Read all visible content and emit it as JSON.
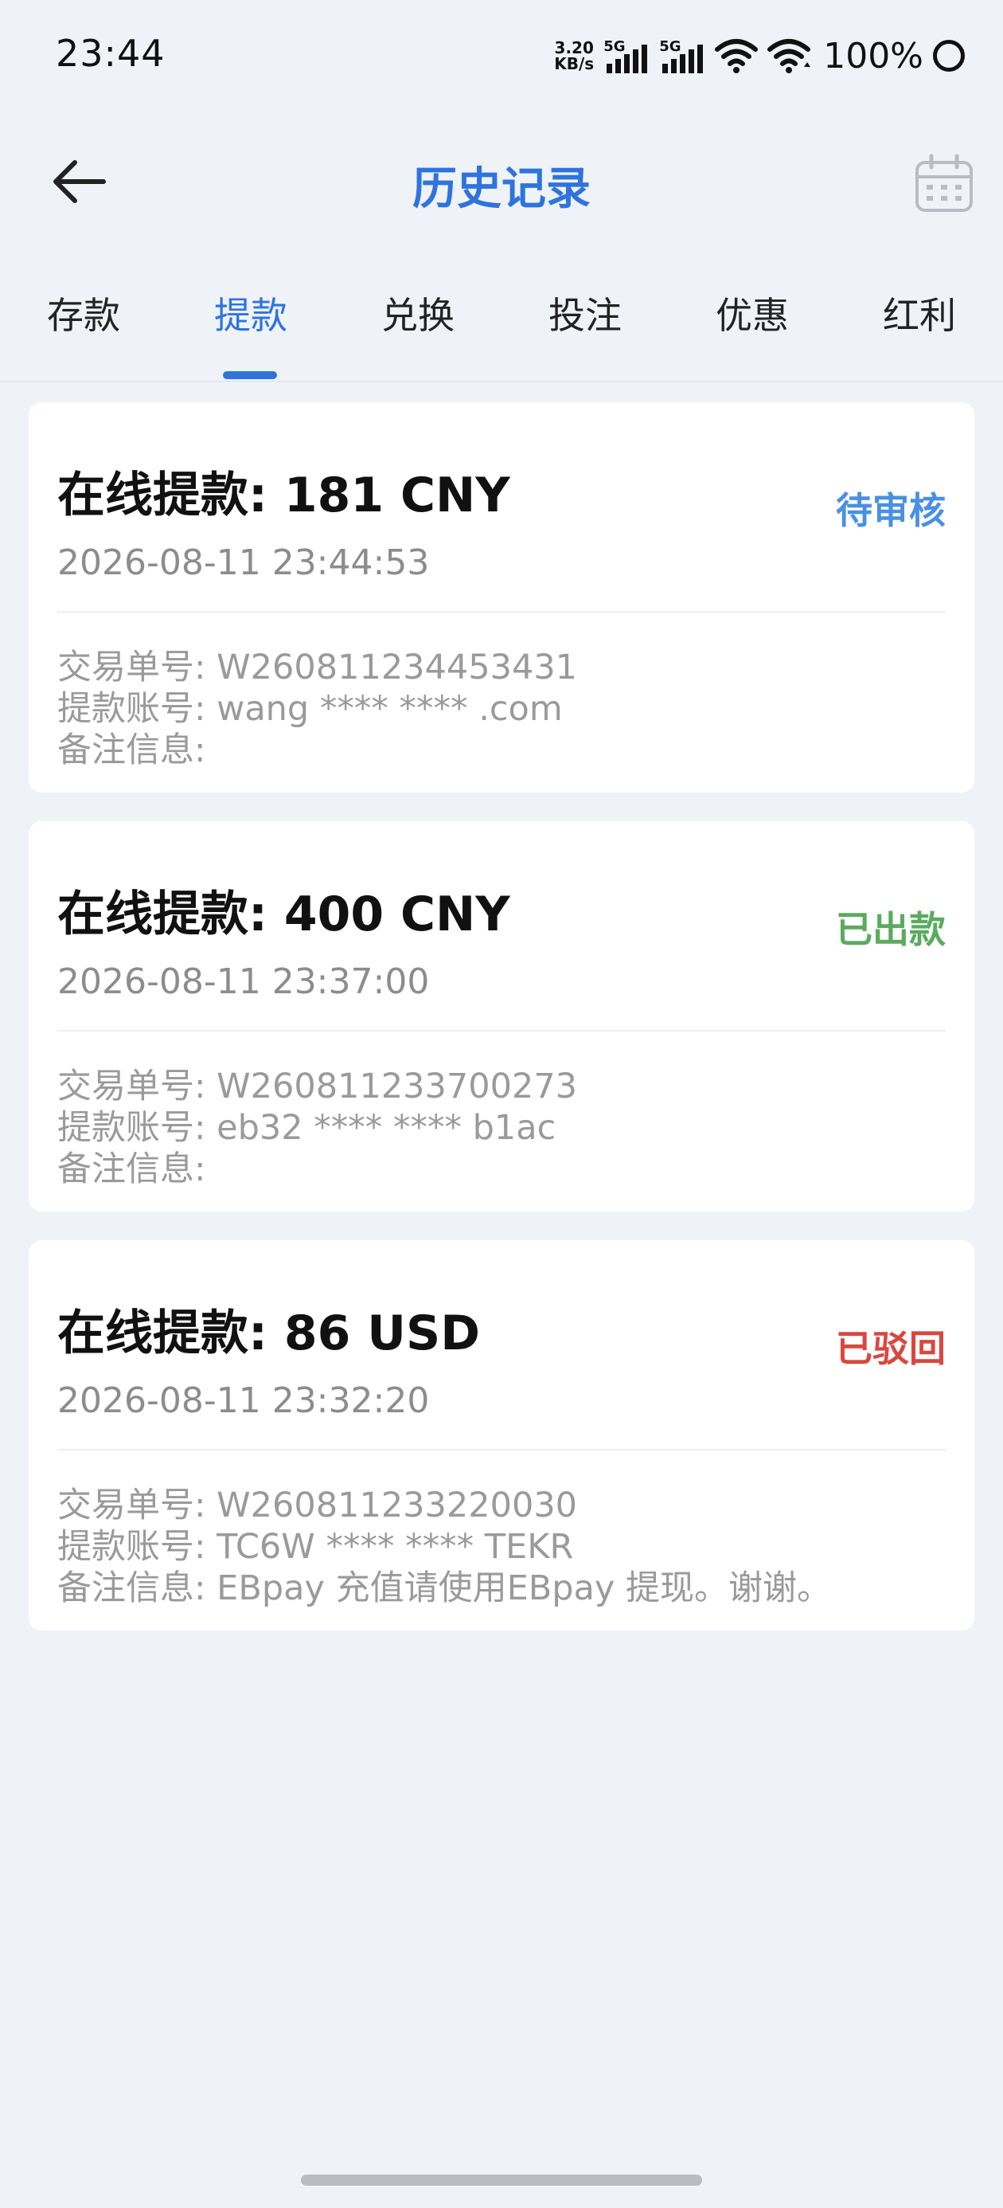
{
  "status_bar": {
    "time": "23:44",
    "net_speed_value": "3.20",
    "net_speed_unit": "KB/s",
    "sim1": "5G",
    "sim2": "5G",
    "battery": "100%"
  },
  "header": {
    "title": "历史记录",
    "back_icon": "arrow-left-icon",
    "calendar_icon": "calendar-icon"
  },
  "tabs": [
    {
      "label": "存款",
      "active": false
    },
    {
      "label": "提款",
      "active": true
    },
    {
      "label": "兑换",
      "active": false
    },
    {
      "label": "投注",
      "active": false
    },
    {
      "label": "优惠",
      "active": false
    },
    {
      "label": "红利",
      "active": false
    }
  ],
  "colors": {
    "accent": "#2f74dd",
    "pending": "#4a90e2",
    "paid": "#5aab5e",
    "rejected": "#d9473f"
  },
  "records": [
    {
      "title": "在线提款: 181 CNY",
      "status": "待审核",
      "time": "2026-08-11 23:44:53",
      "order": "交易单号: W260811234453431",
      "account": "提款账号: wang **** **** .com",
      "note": "备注信息:"
    },
    {
      "title": "在线提款: 400 CNY",
      "status": "已出款",
      "time": "2026-08-11 23:37:00",
      "order": "交易单号: W260811233700273",
      "account": "提款账号: eb32 **** **** b1ac",
      "note": "备注信息:"
    },
    {
      "title": "在线提款: 86 USD",
      "status": "已驳回",
      "time": "2026-08-11 23:32:20",
      "order": "交易单号: W260811233220030",
      "account": "提款账号: TC6W **** **** TEKR",
      "note": "备注信息: EBpay 充值请使用EBpay 提现。谢谢。"
    }
  ]
}
